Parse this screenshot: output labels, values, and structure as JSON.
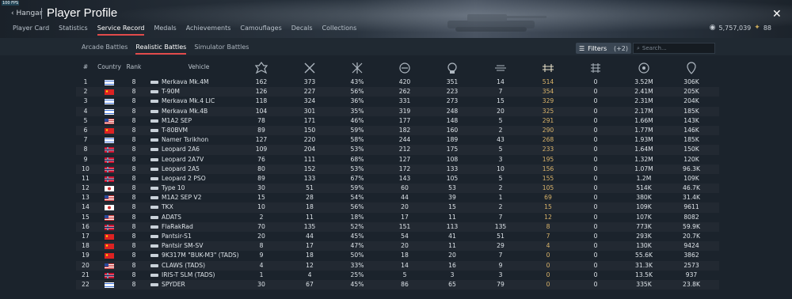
{
  "header": {
    "fps": "100 FPS",
    "back_label": "Hangar",
    "title": "Player Profile",
    "close_icon": "close-icon",
    "tabs": [
      {
        "label": "Player Card"
      },
      {
        "label": "Statistics"
      },
      {
        "label": "Service Record",
        "active": true
      },
      {
        "label": "Medals"
      },
      {
        "label": "Achievements"
      },
      {
        "label": "Camouflages"
      },
      {
        "label": "Decals"
      },
      {
        "label": "Collections"
      }
    ],
    "silver": "5,757,039",
    "gold": "88"
  },
  "subtabs": [
    {
      "label": "Arcade Battles"
    },
    {
      "label": "Realistic Battles",
      "active": true
    },
    {
      "label": "Simulator Battles"
    }
  ],
  "filters": {
    "label": "Filters",
    "count": "(+2)"
  },
  "search": {
    "placeholder": "Search..."
  },
  "columns": {
    "idx": "#",
    "country": "Country",
    "rank": "Rank",
    "vehicle": "Vehicle",
    "stat_icons": [
      "battles-icon",
      "respawns-icon",
      "victories-icon",
      "deaths-icon",
      "ground-kills-icon",
      "air-kills-icon",
      "activity-icon",
      "naval-kills-icon",
      "rp-icon",
      "sl-icon"
    ]
  },
  "rows": [
    {
      "idx": "1",
      "country": "israel",
      "rank": "8",
      "vehicle": "Merkava Mk.4M",
      "s": [
        "162",
        "373",
        "43%",
        "420",
        "351",
        "14",
        "514",
        "0",
        "3.52M",
        "306K"
      ]
    },
    {
      "idx": "2",
      "country": "china",
      "rank": "8",
      "vehicle": "T-90M",
      "s": [
        "126",
        "227",
        "56%",
        "262",
        "223",
        "7",
        "354",
        "0",
        "2.41M",
        "205K"
      ]
    },
    {
      "idx": "3",
      "country": "israel",
      "rank": "8",
      "vehicle": "Merkava Mk.4 LIC",
      "s": [
        "118",
        "324",
        "36%",
        "331",
        "273",
        "15",
        "329",
        "0",
        "2.31M",
        "204K"
      ]
    },
    {
      "idx": "4",
      "country": "israel",
      "rank": "8",
      "vehicle": "Merkava Mk.4B",
      "s": [
        "104",
        "301",
        "35%",
        "319",
        "248",
        "20",
        "325",
        "0",
        "2.17M",
        "185K"
      ]
    },
    {
      "idx": "5",
      "country": "usa",
      "rank": "8",
      "vehicle": "M1A2 SEP",
      "s": [
        "78",
        "171",
        "46%",
        "177",
        "148",
        "5",
        "291",
        "0",
        "1.66M",
        "143K"
      ]
    },
    {
      "idx": "6",
      "country": "china",
      "rank": "8",
      "vehicle": "T-80BVM",
      "s": [
        "89",
        "150",
        "59%",
        "182",
        "160",
        "2",
        "290",
        "0",
        "1.77M",
        "146K"
      ]
    },
    {
      "idx": "7",
      "country": "israel",
      "rank": "8",
      "vehicle": "Namer Tsrikhon",
      "s": [
        "127",
        "220",
        "58%",
        "244",
        "189",
        "43",
        "268",
        "0",
        "1.93M",
        "185K"
      ]
    },
    {
      "idx": "8",
      "country": "norway",
      "rank": "8",
      "vehicle": "Leopard 2A6",
      "s": [
        "109",
        "204",
        "53%",
        "212",
        "175",
        "5",
        "233",
        "0",
        "1.64M",
        "150K"
      ]
    },
    {
      "idx": "9",
      "country": "norway",
      "rank": "8",
      "vehicle": "Leopard 2A7V",
      "s": [
        "76",
        "111",
        "68%",
        "127",
        "108",
        "3",
        "195",
        "0",
        "1.32M",
        "120K"
      ]
    },
    {
      "idx": "10",
      "country": "norway",
      "rank": "8",
      "vehicle": "Leopard 2A5",
      "s": [
        "80",
        "152",
        "53%",
        "172",
        "133",
        "10",
        "156",
        "0",
        "1.07M",
        "96.3K"
      ]
    },
    {
      "idx": "11",
      "country": "norway",
      "rank": "8",
      "vehicle": "Leopard 2 PSO",
      "s": [
        "89",
        "133",
        "67%",
        "143",
        "105",
        "5",
        "155",
        "0",
        "1.2M",
        "109K"
      ]
    },
    {
      "idx": "12",
      "country": "japan",
      "rank": "8",
      "vehicle": "Type 10",
      "s": [
        "30",
        "51",
        "59%",
        "60",
        "53",
        "2",
        "105",
        "0",
        "514K",
        "46.7K"
      ]
    },
    {
      "idx": "13",
      "country": "usa",
      "rank": "8",
      "vehicle": "M1A2 SEP V2",
      "s": [
        "15",
        "28",
        "54%",
        "44",
        "39",
        "1",
        "69",
        "0",
        "380K",
        "31.4K"
      ]
    },
    {
      "idx": "14",
      "country": "japan",
      "rank": "8",
      "vehicle": "TKX",
      "s": [
        "10",
        "18",
        "56%",
        "20",
        "15",
        "2",
        "15",
        "0",
        "109K",
        "9611"
      ]
    },
    {
      "idx": "15",
      "country": "usa",
      "rank": "8",
      "vehicle": "ADATS",
      "s": [
        "2",
        "11",
        "18%",
        "17",
        "11",
        "7",
        "12",
        "0",
        "107K",
        "8082"
      ]
    },
    {
      "idx": "16",
      "country": "norway",
      "rank": "8",
      "vehicle": "FlaRakRad",
      "s": [
        "70",
        "135",
        "52%",
        "151",
        "113",
        "135",
        "8",
        "0",
        "773K",
        "59.9K"
      ]
    },
    {
      "idx": "17",
      "country": "china",
      "rank": "8",
      "vehicle": "Pantsir-S1",
      "s": [
        "20",
        "44",
        "45%",
        "54",
        "41",
        "51",
        "7",
        "0",
        "293K",
        "20.7K"
      ]
    },
    {
      "idx": "18",
      "country": "china",
      "rank": "8",
      "vehicle": "Pantsir SM-SV",
      "s": [
        "8",
        "17",
        "47%",
        "20",
        "11",
        "29",
        "4",
        "0",
        "130K",
        "9424"
      ]
    },
    {
      "idx": "19",
      "country": "china",
      "rank": "8",
      "vehicle": "9K317M \"BUK-M3\" (TADS)",
      "s": [
        "9",
        "18",
        "50%",
        "18",
        "20",
        "7",
        "0",
        "0",
        "55.6K",
        "3862"
      ]
    },
    {
      "idx": "20",
      "country": "usa",
      "rank": "8",
      "vehicle": "CLAWS (TADS)",
      "s": [
        "4",
        "12",
        "33%",
        "14",
        "16",
        "9",
        "0",
        "0",
        "31.3K",
        "2573"
      ]
    },
    {
      "idx": "21",
      "country": "norway",
      "rank": "8",
      "vehicle": "IRIS-T SLM (TADS)",
      "s": [
        "1",
        "4",
        "25%",
        "5",
        "3",
        "3",
        "0",
        "0",
        "13.5K",
        "937"
      ]
    },
    {
      "idx": "22",
      "country": "israel",
      "rank": "8",
      "vehicle": "SPYDER",
      "s": [
        "30",
        "67",
        "45%",
        "86",
        "65",
        "79",
        "0",
        "0",
        "335K",
        "23.8K"
      ]
    }
  ],
  "colors": {
    "accent": "#e24b4b",
    "highlight_value": "#d9b36a"
  }
}
